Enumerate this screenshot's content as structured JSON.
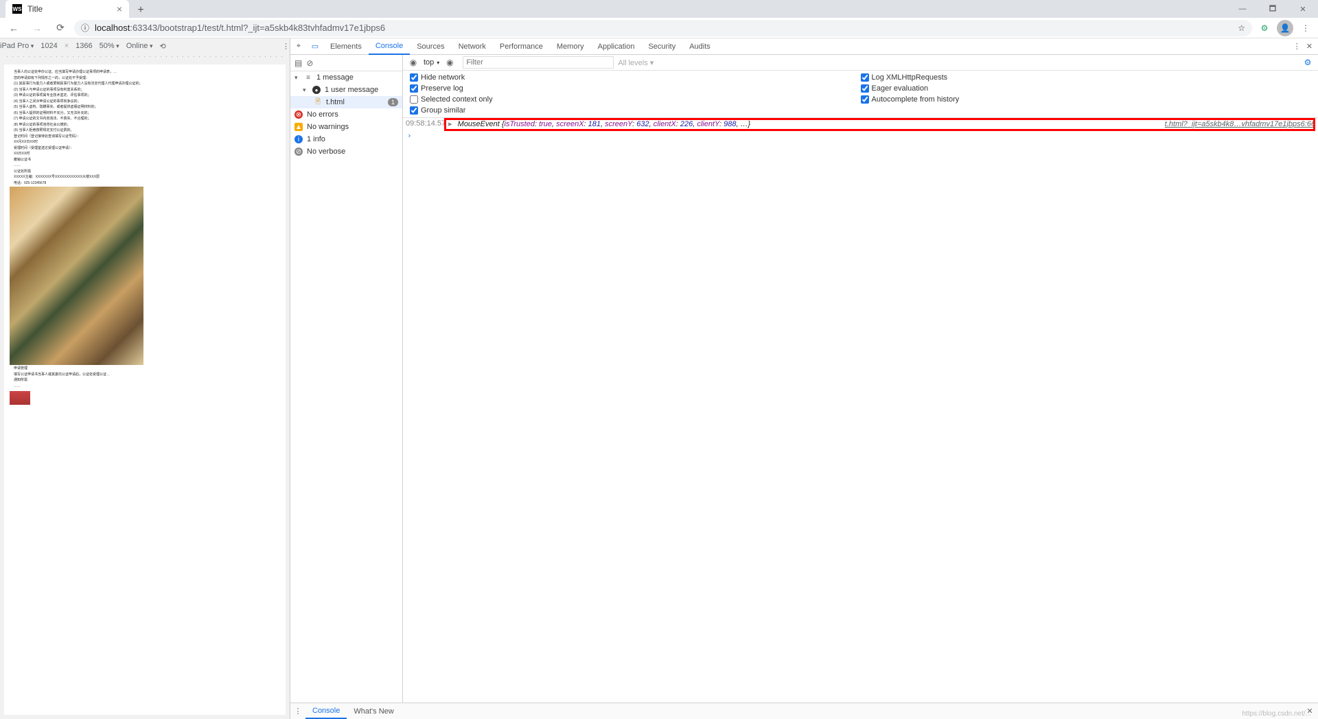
{
  "chrome": {
    "tab_title": "Title",
    "favicon_text": "WS",
    "url_lock_icon": "ⓘ",
    "url_host": "localhost",
    "url_full": ":63343/bootstrap1/test/t.html?_ijt=a5skb4k83tvhfadmv17e1jbps6",
    "star_icon": "☆",
    "window": {
      "min": "—",
      "max": "🗖",
      "close": "✕"
    }
  },
  "device_toolbar": {
    "device": "iPad Pro",
    "width": "1024",
    "height": "1366",
    "zoom": "50%",
    "throttle": "Online",
    "rotate_icon": "⟲"
  },
  "page": {
    "paragraphs": [
      "当事人向公证处申办公证。应当填写申请办理公证事项的申请表，…",
      "您的申请如有下列情形之一的，公证处不予受理：",
      "(1) 其民事行为能力人或者限制民事行为能力人没有法定代理人代理申请办理公证的；",
      "(2) 当事人与申请公证的事项没有利害关系的；",
      "(3) 申请公证的事项属专业技术鉴定、评估事项的；",
      "(4) 当事人之间对申请公证的事项有争议的；",
      "(5) 当事人虚构、隐瞒事实，或者提供虚假证明材料的；",
      "(6) 当事人提供的证明材料不充分，又无法补充的；",
      "(7) 申请公证的文书内容违法、不真实、不合理的；",
      "(8) 申请公证的事项违背社会公德的；",
      "(9) 当事人拒绝按照规定支付公证费的。",
      "登记时间（登记接待处查询填写公证号码）：",
      "XX月XX日XX时",
      "受理时间（受理室送达受理公证申请）：",
      "XX日XX时",
      "撤销公证书",
      "……",
      "公证处所需",
      "XXXXX主编：XXXXXXX号XXXXXXXXXXXX大楼XXX层",
      "电话：025-12345678",
      "申请管理",
      "填写公证申请书当事人或其委托公证申请后，公证处受理公证…",
      "通知所需",
      "……"
    ]
  },
  "devtools": {
    "tabs": [
      "Elements",
      "Console",
      "Sources",
      "Network",
      "Performance",
      "Memory",
      "Application",
      "Security",
      "Audits"
    ],
    "active_tab": "Console"
  },
  "sidebar": {
    "items": [
      {
        "icon": "msg",
        "label": "1 message",
        "caret": true
      },
      {
        "icon": "user",
        "label": "1 user message",
        "caret": true,
        "level": 2
      },
      {
        "icon": "file",
        "label": "t.html",
        "badge": "1",
        "level": 3,
        "sel": true
      },
      {
        "icon": "err",
        "label": "No errors"
      },
      {
        "icon": "warn",
        "label": "No warnings"
      },
      {
        "icon": "info",
        "label": "1 info"
      },
      {
        "icon": "verb",
        "label": "No verbose"
      }
    ]
  },
  "console": {
    "context": "top",
    "filter_placeholder": "Filter",
    "levels": "All levels ▾",
    "eye_icon": "◉",
    "options_left": [
      {
        "label": "Hide network",
        "checked": true
      },
      {
        "label": "Preserve log",
        "checked": true
      },
      {
        "label": "Selected context only",
        "checked": false
      },
      {
        "label": "Group similar",
        "checked": true
      }
    ],
    "options_right": [
      {
        "label": "Log XMLHttpRequests",
        "checked": true
      },
      {
        "label": "Eager evaluation",
        "checked": true
      },
      {
        "label": "Autocomplete from history",
        "checked": true
      }
    ],
    "log_time": "09:58:14.",
    "log_time_suffix": "57",
    "log_text": "MouseEvent {isTrusted: true, screenX: 181, screenY: 632, clientX: 226, clientY: 988, …}",
    "log_link": "t.html?_ijt=a5skb4k8…vhfadmv17e1jbps6:66"
  },
  "drawer": {
    "tabs": [
      "Console",
      "What's New"
    ]
  },
  "footer": "https://blog.csdn.net/..."
}
